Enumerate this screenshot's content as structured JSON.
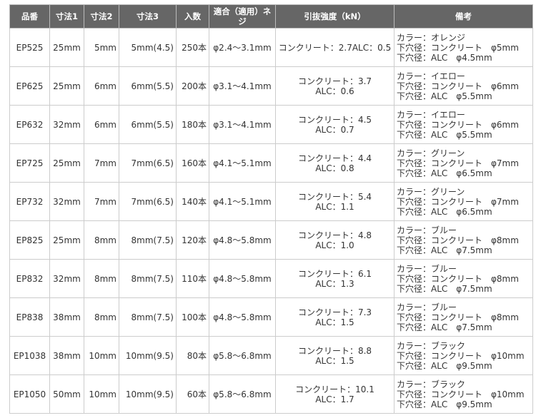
{
  "headers": [
    "品番",
    "寸法1",
    "寸法2",
    "寸法3",
    "入数",
    "適合（適用）ネジ",
    "引抜強度（kN）",
    "備考"
  ],
  "rows": [
    {
      "part": "EP525",
      "dim1": "25mm",
      "dim2": "5mm",
      "dim3": "5mm(4.5)",
      "qty": "250本",
      "screw": "φ2.4～3.1mm",
      "strength": [
        "コンクリート：2.7ALC：0.5"
      ],
      "notes": [
        "カラー：オレンジ",
        "下穴径：コンクリート　φ5mm",
        "下穴径：ALC　φ4.5mm"
      ]
    },
    {
      "part": "EP625",
      "dim1": "25mm",
      "dim2": "6mm",
      "dim3": "6mm(5.5)",
      "qty": "200本",
      "screw": "φ3.1～4.1mm",
      "strength": [
        "コンクリート：3.7",
        "ALC：0.6"
      ],
      "notes": [
        "カラー：イエロー",
        "下穴径：コンクリート　φ6mm",
        "下穴径：ALC　φ5.5mm"
      ]
    },
    {
      "part": "EP632",
      "dim1": "32mm",
      "dim2": "6mm",
      "dim3": "6mm(5.5)",
      "qty": "180本",
      "screw": "φ3.1～4.1mm",
      "strength": [
        "コンクリート：4.5",
        "ALC：0.7"
      ],
      "notes": [
        "カラー：イエロー",
        "下穴径：コンクリート　φ6mm",
        "下穴径：ALC　φ5.5mm"
      ]
    },
    {
      "part": "EP725",
      "dim1": "25mm",
      "dim2": "7mm",
      "dim3": "7mm(6.5)",
      "qty": "160本",
      "screw": "φ4.1～5.1mm",
      "strength": [
        "コンクリート：4.4",
        "ALC：0.8"
      ],
      "notes": [
        "カラー：グリーン",
        "下穴径：コンクリート　φ7mm",
        "下穴径：ALC　φ6.5mm"
      ]
    },
    {
      "part": "EP732",
      "dim1": "32mm",
      "dim2": "7mm",
      "dim3": "7mm(6.5)",
      "qty": "140本",
      "screw": "φ4.1～5.1mm",
      "strength": [
        "コンクリート：5.4",
        "ALC：1.1"
      ],
      "notes": [
        "カラー：グリーン",
        "下穴径：コンクリート　φ7mm",
        "下穴径：ALC　φ6.5mm"
      ]
    },
    {
      "part": "EP825",
      "dim1": "25mm",
      "dim2": "8mm",
      "dim3": "8mm(7.5)",
      "qty": "120本",
      "screw": "φ4.8～5.8mm",
      "strength": [
        "コンクリート：4.8",
        "ALC：1.0"
      ],
      "notes": [
        "カラー：ブルー",
        "下穴径：コンクリート　φ8mm",
        "下穴径：ALC　φ7.5mm"
      ]
    },
    {
      "part": "EP832",
      "dim1": "32mm",
      "dim2": "8mm",
      "dim3": "8mm(7.5)",
      "qty": "110本",
      "screw": "φ4.8～5.8mm",
      "strength": [
        "コンクリート：6.1",
        "ALC：1.3"
      ],
      "notes": [
        "カラー：ブルー",
        "下穴径：コンクリート　φ8mm",
        "下穴径：ALC　φ7.5mm"
      ]
    },
    {
      "part": "EP838",
      "dim1": "38mm",
      "dim2": "8mm",
      "dim3": "8mm(7.5)",
      "qty": "100本",
      "screw": "φ4.8～5.8mm",
      "strength": [
        "コンクリート：7.3",
        "ALC：1.5"
      ],
      "notes": [
        "カラー：ブルー",
        "下穴径：コンクリート　φ8mm",
        "下穴径：ALC　φ7.5mm"
      ]
    },
    {
      "part": "EP1038",
      "dim1": "38mm",
      "dim2": "10mm",
      "dim3": "10mm(9.5)",
      "qty": "80本",
      "screw": "φ5.8～6.8mm",
      "strength": [
        "コンクリート：8.8",
        "ALC：1.5"
      ],
      "notes": [
        "カラー：ブラック",
        "下穴径：コンクリート　φ10mm",
        "下穴径：ALC　φ9.5mm"
      ]
    },
    {
      "part": "EP1050",
      "dim1": "50mm",
      "dim2": "10mm",
      "dim3": "10mm(9.5)",
      "qty": "60本",
      "screw": "φ5.8～6.8mm",
      "strength": [
        "コンクリート：10.1",
        "ALC：1.7"
      ],
      "notes": [
        "カラー：ブラック",
        "下穴径：コンクリート　φ10mm",
        "下穴径：ALC　φ9.5mm"
      ]
    }
  ]
}
